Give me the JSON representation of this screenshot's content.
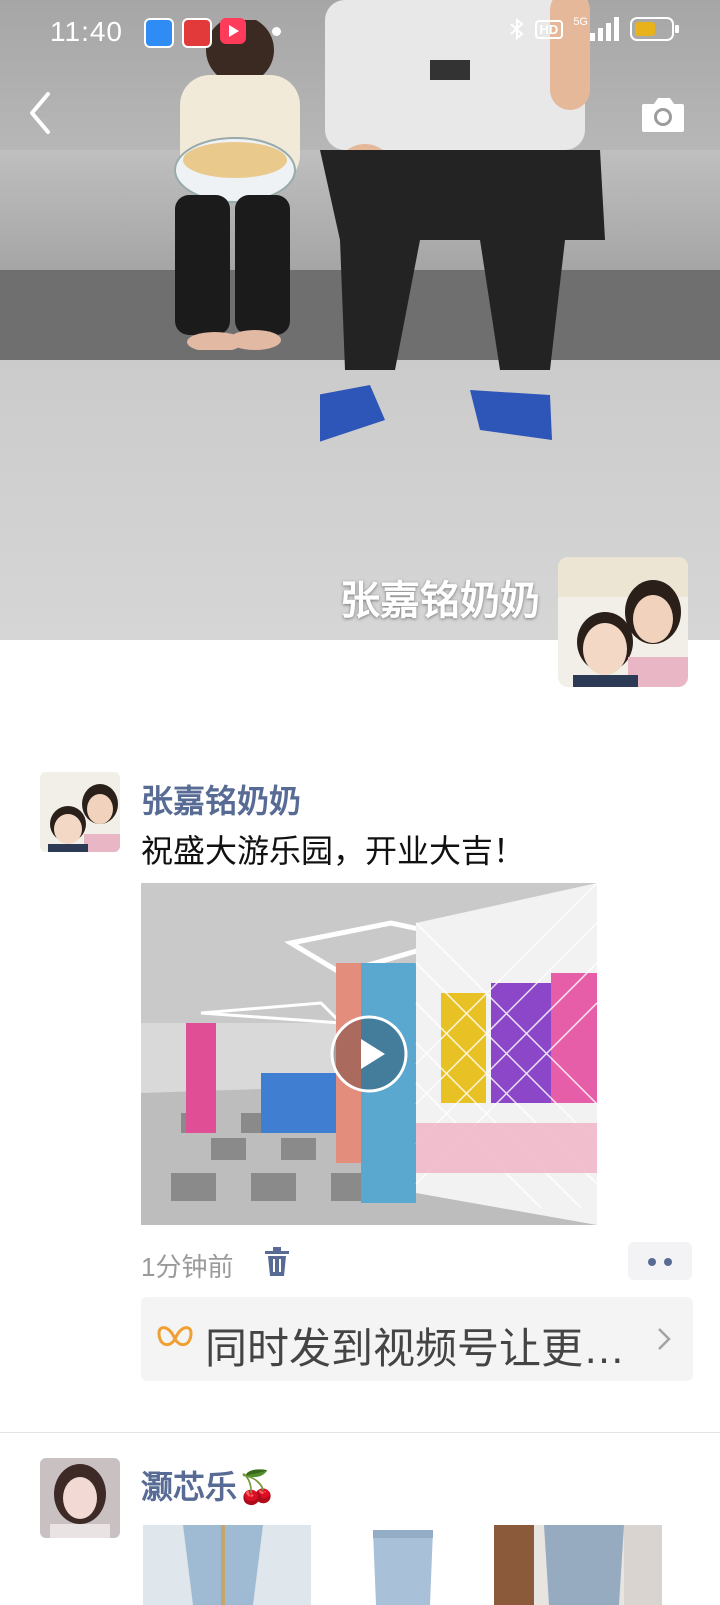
{
  "status_bar": {
    "time": "11:40",
    "signal_label": "HD",
    "network_label": "5G"
  },
  "cover": {
    "name": "张嘉铭奶奶"
  },
  "posts": [
    {
      "author": "张嘉铭奶奶",
      "text": "祝盛大游乐园，开业大吉！",
      "time": "1分钟前",
      "channel_promo": "同时发到视频号让更多人看到"
    },
    {
      "author": "灏芯乐🍒"
    }
  ],
  "colors": {
    "author_link": "#576b95",
    "channel_icon": "#f0a033",
    "meta": "#9a9a9a"
  }
}
